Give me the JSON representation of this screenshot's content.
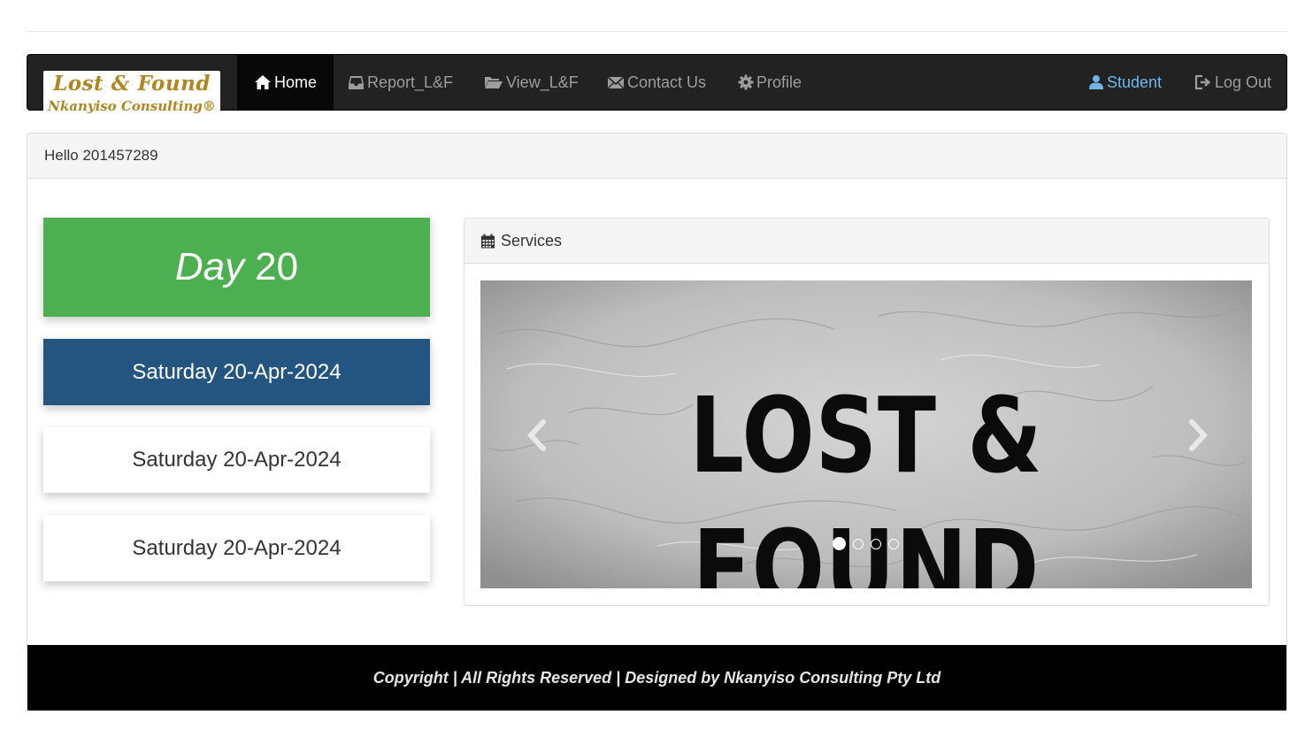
{
  "logo": {
    "line1": "Lost & Found",
    "line2": "Nkanyiso Consulting®"
  },
  "nav": {
    "items": [
      {
        "label": "Home",
        "icon": "home-icon",
        "active": true
      },
      {
        "label": "Report_L&F",
        "icon": "inbox-icon"
      },
      {
        "label": "View_L&F",
        "icon": "folder-open-icon"
      },
      {
        "label": "Contact Us",
        "icon": "envelope-icon"
      },
      {
        "label": "Profile",
        "icon": "gear-icon"
      }
    ],
    "right": [
      {
        "label": "Student",
        "icon": "user-icon"
      },
      {
        "label": "Log Out",
        "icon": "log-out-icon"
      }
    ]
  },
  "greeting": "Hello 201457289",
  "tiles": {
    "day_word": "Day",
    "day_number": "20",
    "date1": "Saturday 20-Apr-2024",
    "date2": "Saturday 20-Apr-2024",
    "date3": "Saturday 20-Apr-2024"
  },
  "services": {
    "title": "Services",
    "icon": "calendar-icon",
    "slide_text": "LOST & FOUND",
    "slide_count": 4,
    "active_slide": 1
  },
  "footer": "Copyright | All Rights Reserved | Designed by Nkanyiso Consulting Pty Ltd",
  "colors": {
    "navbar": "#222222",
    "accent_green": "#4caf50",
    "accent_blue": "#245580",
    "logo_gold": "#b0861e",
    "student_link": "#6fb6e8"
  }
}
